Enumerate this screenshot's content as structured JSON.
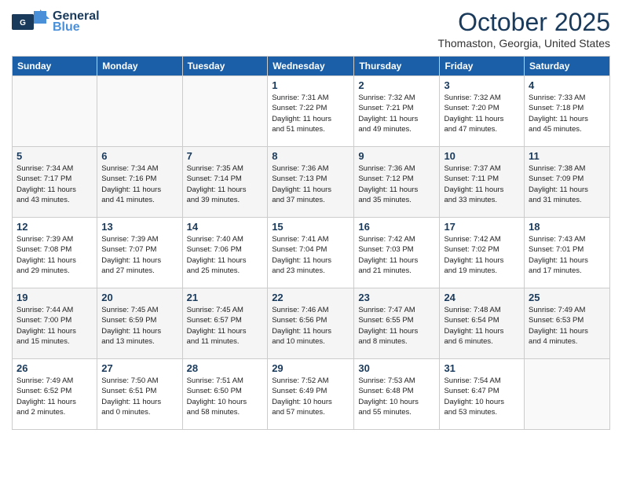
{
  "header": {
    "logo_general": "General",
    "logo_blue": "Blue",
    "month": "October 2025",
    "location": "Thomaston, Georgia, United States"
  },
  "weekdays": [
    "Sunday",
    "Monday",
    "Tuesday",
    "Wednesday",
    "Thursday",
    "Friday",
    "Saturday"
  ],
  "weeks": [
    [
      {
        "day": "",
        "info": ""
      },
      {
        "day": "",
        "info": ""
      },
      {
        "day": "",
        "info": ""
      },
      {
        "day": "1",
        "info": "Sunrise: 7:31 AM\nSunset: 7:22 PM\nDaylight: 11 hours\nand 51 minutes."
      },
      {
        "day": "2",
        "info": "Sunrise: 7:32 AM\nSunset: 7:21 PM\nDaylight: 11 hours\nand 49 minutes."
      },
      {
        "day": "3",
        "info": "Sunrise: 7:32 AM\nSunset: 7:20 PM\nDaylight: 11 hours\nand 47 minutes."
      },
      {
        "day": "4",
        "info": "Sunrise: 7:33 AM\nSunset: 7:18 PM\nDaylight: 11 hours\nand 45 minutes."
      }
    ],
    [
      {
        "day": "5",
        "info": "Sunrise: 7:34 AM\nSunset: 7:17 PM\nDaylight: 11 hours\nand 43 minutes."
      },
      {
        "day": "6",
        "info": "Sunrise: 7:34 AM\nSunset: 7:16 PM\nDaylight: 11 hours\nand 41 minutes."
      },
      {
        "day": "7",
        "info": "Sunrise: 7:35 AM\nSunset: 7:14 PM\nDaylight: 11 hours\nand 39 minutes."
      },
      {
        "day": "8",
        "info": "Sunrise: 7:36 AM\nSunset: 7:13 PM\nDaylight: 11 hours\nand 37 minutes."
      },
      {
        "day": "9",
        "info": "Sunrise: 7:36 AM\nSunset: 7:12 PM\nDaylight: 11 hours\nand 35 minutes."
      },
      {
        "day": "10",
        "info": "Sunrise: 7:37 AM\nSunset: 7:11 PM\nDaylight: 11 hours\nand 33 minutes."
      },
      {
        "day": "11",
        "info": "Sunrise: 7:38 AM\nSunset: 7:09 PM\nDaylight: 11 hours\nand 31 minutes."
      }
    ],
    [
      {
        "day": "12",
        "info": "Sunrise: 7:39 AM\nSunset: 7:08 PM\nDaylight: 11 hours\nand 29 minutes."
      },
      {
        "day": "13",
        "info": "Sunrise: 7:39 AM\nSunset: 7:07 PM\nDaylight: 11 hours\nand 27 minutes."
      },
      {
        "day": "14",
        "info": "Sunrise: 7:40 AM\nSunset: 7:06 PM\nDaylight: 11 hours\nand 25 minutes."
      },
      {
        "day": "15",
        "info": "Sunrise: 7:41 AM\nSunset: 7:04 PM\nDaylight: 11 hours\nand 23 minutes."
      },
      {
        "day": "16",
        "info": "Sunrise: 7:42 AM\nSunset: 7:03 PM\nDaylight: 11 hours\nand 21 minutes."
      },
      {
        "day": "17",
        "info": "Sunrise: 7:42 AM\nSunset: 7:02 PM\nDaylight: 11 hours\nand 19 minutes."
      },
      {
        "day": "18",
        "info": "Sunrise: 7:43 AM\nSunset: 7:01 PM\nDaylight: 11 hours\nand 17 minutes."
      }
    ],
    [
      {
        "day": "19",
        "info": "Sunrise: 7:44 AM\nSunset: 7:00 PM\nDaylight: 11 hours\nand 15 minutes."
      },
      {
        "day": "20",
        "info": "Sunrise: 7:45 AM\nSunset: 6:59 PM\nDaylight: 11 hours\nand 13 minutes."
      },
      {
        "day": "21",
        "info": "Sunrise: 7:45 AM\nSunset: 6:57 PM\nDaylight: 11 hours\nand 11 minutes."
      },
      {
        "day": "22",
        "info": "Sunrise: 7:46 AM\nSunset: 6:56 PM\nDaylight: 11 hours\nand 10 minutes."
      },
      {
        "day": "23",
        "info": "Sunrise: 7:47 AM\nSunset: 6:55 PM\nDaylight: 11 hours\nand 8 minutes."
      },
      {
        "day": "24",
        "info": "Sunrise: 7:48 AM\nSunset: 6:54 PM\nDaylight: 11 hours\nand 6 minutes."
      },
      {
        "day": "25",
        "info": "Sunrise: 7:49 AM\nSunset: 6:53 PM\nDaylight: 11 hours\nand 4 minutes."
      }
    ],
    [
      {
        "day": "26",
        "info": "Sunrise: 7:49 AM\nSunset: 6:52 PM\nDaylight: 11 hours\nand 2 minutes."
      },
      {
        "day": "27",
        "info": "Sunrise: 7:50 AM\nSunset: 6:51 PM\nDaylight: 11 hours\nand 0 minutes."
      },
      {
        "day": "28",
        "info": "Sunrise: 7:51 AM\nSunset: 6:50 PM\nDaylight: 10 hours\nand 58 minutes."
      },
      {
        "day": "29",
        "info": "Sunrise: 7:52 AM\nSunset: 6:49 PM\nDaylight: 10 hours\nand 57 minutes."
      },
      {
        "day": "30",
        "info": "Sunrise: 7:53 AM\nSunset: 6:48 PM\nDaylight: 10 hours\nand 55 minutes."
      },
      {
        "day": "31",
        "info": "Sunrise: 7:54 AM\nSunset: 6:47 PM\nDaylight: 10 hours\nand 53 minutes."
      },
      {
        "day": "",
        "info": ""
      }
    ]
  ]
}
